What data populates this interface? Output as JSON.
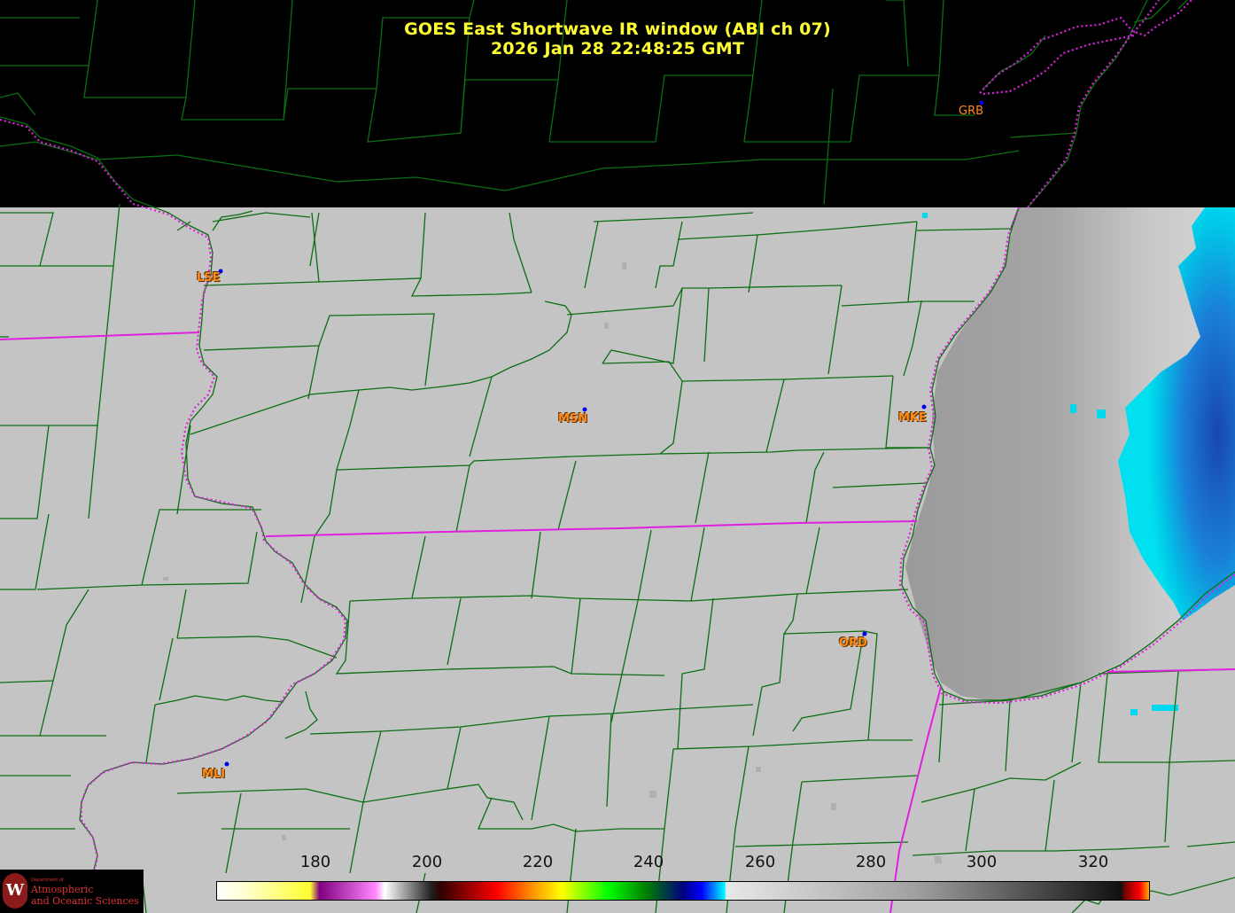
{
  "title": {
    "line1": "GOES East Shortwave IR window (ABI ch 07)",
    "line2": "2026 Jan 28  22:48:25 GMT"
  },
  "stations": [
    {
      "id": "LSE",
      "label": "LSE"
    },
    {
      "id": "MSN",
      "label": "MSN"
    },
    {
      "id": "MKE",
      "label": "MKE"
    },
    {
      "id": "ORD",
      "label": "ORD"
    },
    {
      "id": "MLI",
      "label": "MLI"
    },
    {
      "id": "GRB",
      "label": "GRB"
    }
  ],
  "colorbar": {
    "ticks": [
      "180",
      "200",
      "220",
      "240",
      "260",
      "280",
      "300",
      "320"
    ]
  },
  "logo": {
    "seal": "W",
    "dept": "Department of",
    "line2": "Atmospheric",
    "line3": "and Oceanic Sciences"
  },
  "colors": {
    "background_land": "#c4c4c4",
    "no_data": "#000000",
    "county_lines": "#0b6e12",
    "state_lines": "#e020e0",
    "title_text": "#ffff33",
    "station_text": "#ff8c1a",
    "cold_cloud": "#1a5fd0",
    "very_cold_cloud": "#00d8f0"
  }
}
